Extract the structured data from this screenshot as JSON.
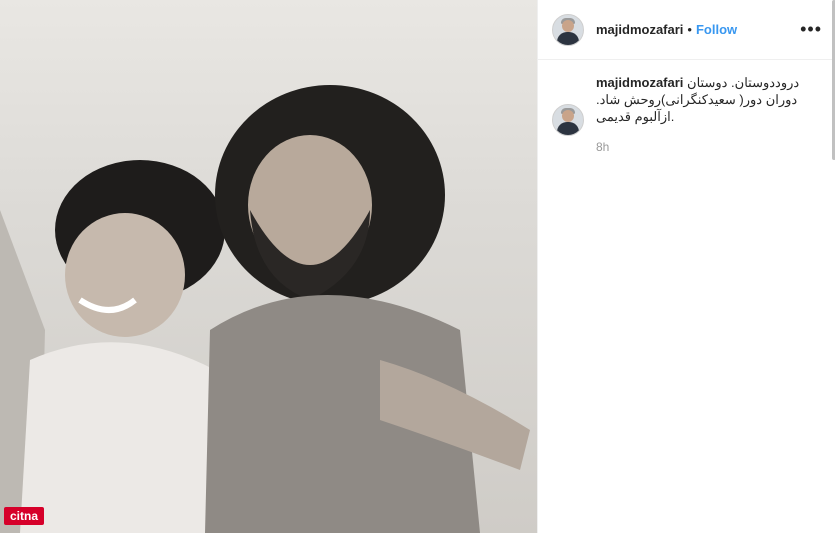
{
  "post": {
    "username": "majidmozafari",
    "separator": "•",
    "follow_label": "Follow",
    "more_icon": "more-icon",
    "caption_lines": [
      "دروددوستان. دوستان",
      "دوران دور( سعیدکنگرانی)روحش شاد.",
      ".ازآلبوم قدیمی"
    ],
    "time": "8h"
  },
  "watermark": {
    "text": "citna",
    "color": "#d6002a"
  },
  "colors": {
    "link": "#3897f0",
    "text": "#262626",
    "muted": "#999999"
  }
}
